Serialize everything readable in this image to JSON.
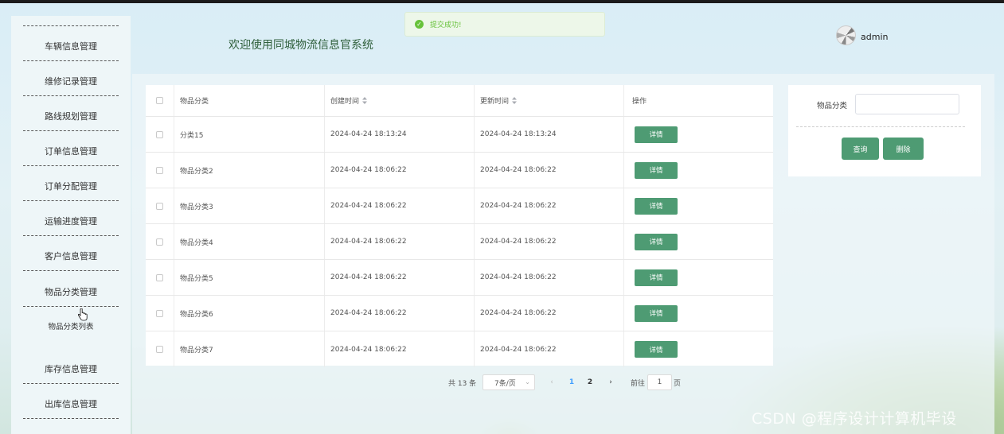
{
  "header": {
    "site_title": "欢迎使用同城物流信息官系统",
    "username": "admin"
  },
  "toast": {
    "message": "提交成功!"
  },
  "sidebar": {
    "items": [
      {
        "label": "车辆信息管理"
      },
      {
        "label": "维修记录管理"
      },
      {
        "label": "路线规划管理"
      },
      {
        "label": "订单信息管理"
      },
      {
        "label": "订单分配管理"
      },
      {
        "label": "运输进度管理"
      },
      {
        "label": "客户信息管理"
      },
      {
        "label": "物品分类管理"
      },
      {
        "label": "库存信息管理"
      },
      {
        "label": "出库信息管理"
      }
    ],
    "submenu_label": "物品分类列表"
  },
  "table": {
    "headers": [
      "物品分类",
      "创建时间",
      "更新时间",
      "操作"
    ],
    "detail_label": "详情",
    "rows": [
      {
        "category": "分类15",
        "created": "2024-04-24 18:13:24",
        "updated": "2024-04-24 18:13:24"
      },
      {
        "category": "物品分类2",
        "created": "2024-04-24 18:06:22",
        "updated": "2024-04-24 18:06:22"
      },
      {
        "category": "物品分类3",
        "created": "2024-04-24 18:06:22",
        "updated": "2024-04-24 18:06:22"
      },
      {
        "category": "物品分类4",
        "created": "2024-04-24 18:06:22",
        "updated": "2024-04-24 18:06:22"
      },
      {
        "category": "物品分类5",
        "created": "2024-04-24 18:06:22",
        "updated": "2024-04-24 18:06:22"
      },
      {
        "category": "物品分类6",
        "created": "2024-04-24 18:06:22",
        "updated": "2024-04-24 18:06:22"
      },
      {
        "category": "物品分类7",
        "created": "2024-04-24 18:06:22",
        "updated": "2024-04-24 18:06:22"
      }
    ]
  },
  "pagination": {
    "total": "共 13 条",
    "page_size": "7条/页",
    "pages": [
      "1",
      "2"
    ],
    "current_page": "1",
    "goto_label": "前往",
    "goto_value": "1",
    "page_suffix": "页"
  },
  "search": {
    "label": "物品分类",
    "value": "",
    "query_label": "查询",
    "delete_label": "删除"
  },
  "watermark": "CSDN @程序设计计算机毕设",
  "colors": {
    "primary_button": "#4e9b73",
    "toast_success": "#67c23a",
    "active_page": "#409eff"
  }
}
